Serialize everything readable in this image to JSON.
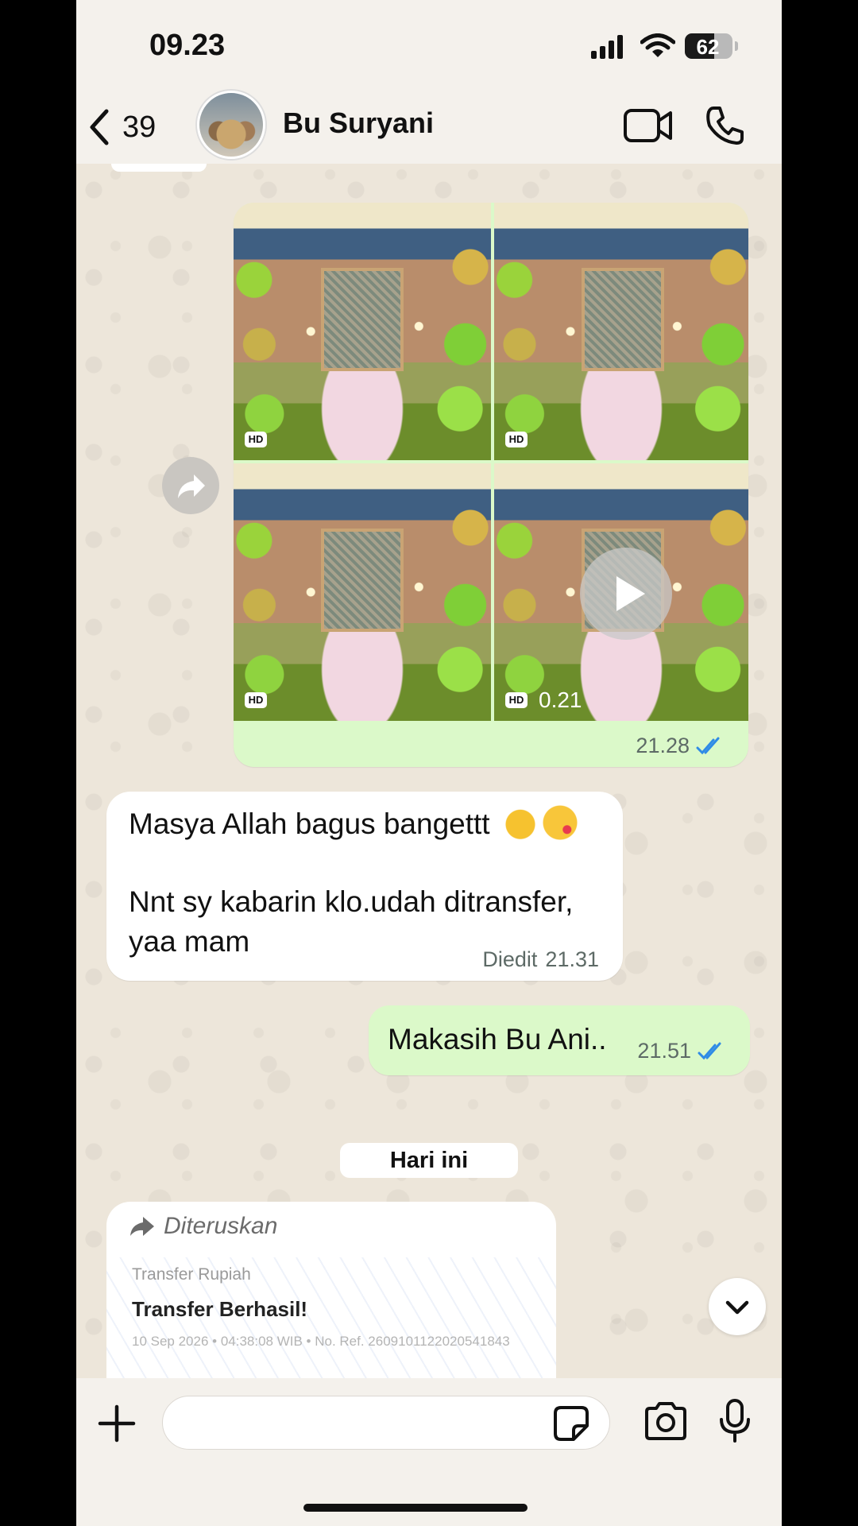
{
  "status_bar": {
    "time": "09.23",
    "battery": "62",
    "battery_level": 0.62
  },
  "header": {
    "back_count": "39",
    "contact_name": "Bu Suryani"
  },
  "messages": {
    "media": {
      "tiles": [
        {
          "badge": "HD",
          "type": "image"
        },
        {
          "badge": "HD",
          "type": "image"
        },
        {
          "badge": "HD",
          "type": "image"
        },
        {
          "badge": "HD",
          "type": "video",
          "duration": "0.21"
        }
      ],
      "time": "21.28",
      "status": "read"
    },
    "incoming_1": {
      "line1": "Masya Allah bagus bangettt",
      "emojis": [
        "thumbs-up",
        "kiss"
      ],
      "line2": "Nnt sy kabarin klo.udah ditransfer,",
      "line3": "yaa mam",
      "edited_label": "Diedit",
      "time": "21.31"
    },
    "outgoing_2": {
      "text": "Makasih Bu Ani..",
      "time": "21.51",
      "status": "read"
    },
    "day_separator": "Hari ini",
    "forwarded": {
      "label": "Diteruskan",
      "receipt_small": "Transfer Rupiah",
      "receipt_title": "Transfer Berhasil!",
      "receipt_ref": "10 Sep 2026 • 04:38:08 WIB • No. Ref. 2609101122020541843"
    }
  },
  "colors": {
    "outgoing_bubble": "#dbf9c9",
    "incoming_bubble": "#ffffff",
    "read_ticks": "#2f8be6",
    "chat_bg": "#ede6da"
  },
  "icons": [
    "back-chevron-icon",
    "video-call-icon",
    "phone-icon",
    "forward-icon",
    "play-icon",
    "double-check-icon",
    "chevron-down-icon",
    "plus-icon",
    "sticker-icon",
    "camera-icon",
    "mic-icon"
  ]
}
